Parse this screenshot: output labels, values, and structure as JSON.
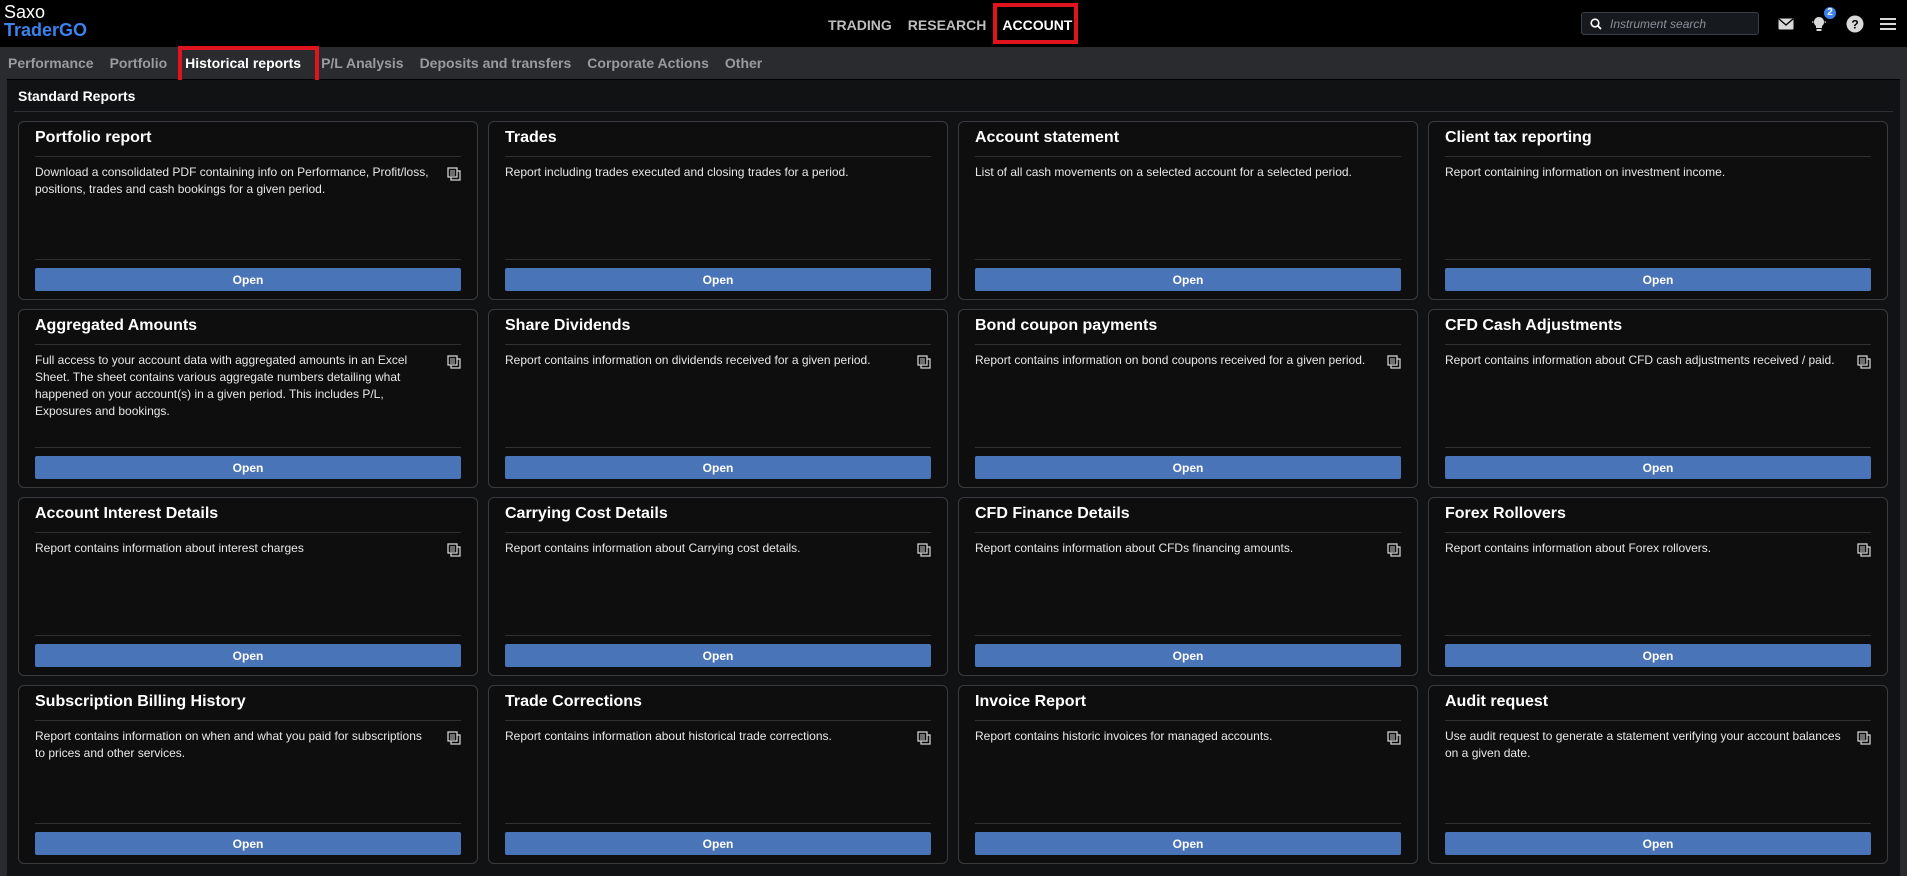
{
  "brand": {
    "line1": "Saxo",
    "line2": "TraderGO"
  },
  "main_nav": [
    {
      "label": "TRADING",
      "active": false
    },
    {
      "label": "RESEARCH",
      "active": false
    },
    {
      "label": "ACCOUNT",
      "active": true
    }
  ],
  "search": {
    "placeholder": "Instrument search"
  },
  "top_icons": [
    {
      "name": "mail-icon"
    },
    {
      "name": "lightbulb-icon",
      "badge": "2"
    },
    {
      "name": "help-icon"
    },
    {
      "name": "menu-icon"
    }
  ],
  "sub_nav": [
    {
      "label": "Performance",
      "active": false
    },
    {
      "label": "Portfolio",
      "active": false
    },
    {
      "label": "Historical reports",
      "active": true
    },
    {
      "label": "P/L Analysis",
      "active": false
    },
    {
      "label": "Deposits and transfers",
      "active": false
    },
    {
      "label": "Corporate Actions",
      "active": false
    },
    {
      "label": "Other",
      "active": false
    }
  ],
  "section_title": "Standard Reports",
  "open_label": "Open",
  "colors": {
    "accent": "#3b82ea",
    "button": "#4a74b8",
    "highlight": "#e0141e"
  },
  "reports": [
    {
      "title": "Portfolio report",
      "desc": "Download a consolidated PDF containing info on Performance, Profit/loss, positions, trades and cash bookings for a given period.",
      "copy": true
    },
    {
      "title": "Trades",
      "desc": "Report including trades executed and closing trades for a period.",
      "copy": false
    },
    {
      "title": "Account statement",
      "desc": "List of all cash movements on a selected account for a selected period.",
      "copy": false
    },
    {
      "title": "Client tax reporting",
      "desc": "Report containing information on investment income.",
      "copy": false
    },
    {
      "title": "Aggregated Amounts",
      "desc": "Full access to your account data with aggregated amounts in an Excel Sheet. The sheet contains various aggregate numbers detailing what happened on your account(s) in a given period. This includes P/L, Exposures and bookings.",
      "copy": true
    },
    {
      "title": "Share Dividends",
      "desc": "Report contains information on dividends received for a given period.",
      "copy": true
    },
    {
      "title": "Bond coupon payments",
      "desc": "Report contains information on bond coupons received for a given period.",
      "copy": true
    },
    {
      "title": "CFD Cash Adjustments",
      "desc": "Report contains information about CFD cash adjustments received / paid.",
      "copy": true
    },
    {
      "title": "Account Interest Details",
      "desc": "Report contains information about interest charges",
      "copy": true
    },
    {
      "title": "Carrying Cost Details",
      "desc": "Report contains information about Carrying cost details.",
      "copy": true
    },
    {
      "title": "CFD Finance Details",
      "desc": "Report contains information about CFDs financing amounts.",
      "copy": true
    },
    {
      "title": "Forex Rollovers",
      "desc": "Report contains information about Forex rollovers.",
      "copy": true
    },
    {
      "title": "Subscription Billing History",
      "desc": "Report contains information on when and what you paid for subscriptions to prices and other services.",
      "copy": true
    },
    {
      "title": "Trade Corrections",
      "desc": "Report contains information about historical trade corrections.",
      "copy": true
    },
    {
      "title": "Invoice Report",
      "desc": "Report contains historic invoices for managed accounts.",
      "copy": true
    },
    {
      "title": "Audit request",
      "desc": "Use audit request to generate a statement verifying your account balances on a given date.",
      "copy": true
    }
  ]
}
